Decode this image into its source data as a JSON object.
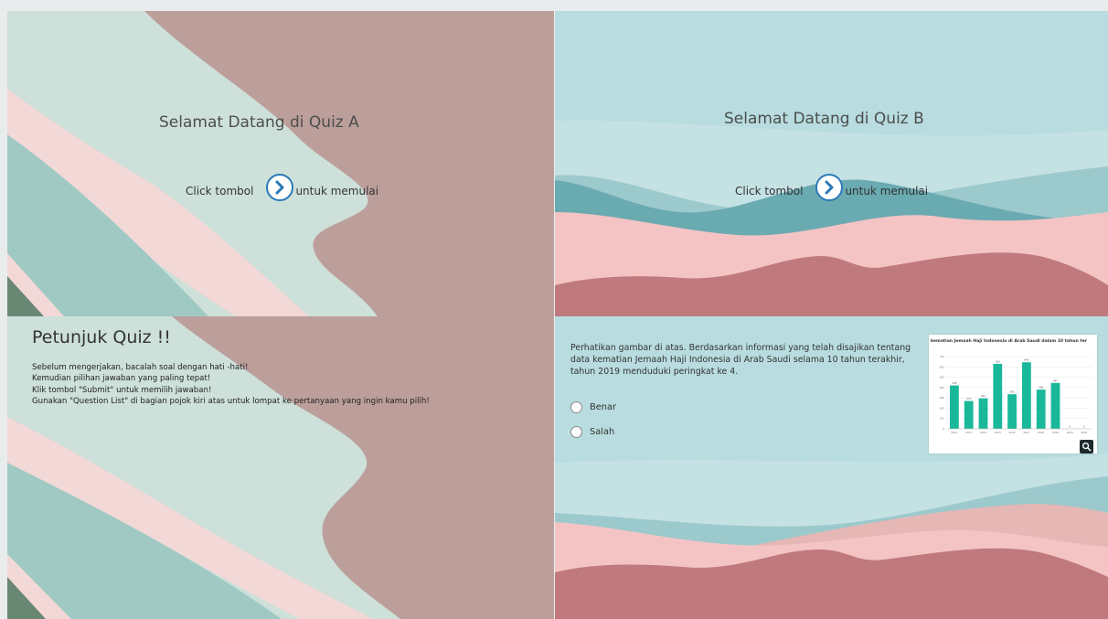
{
  "slide_a": {
    "title": "Selamat Datang di Quiz  A",
    "start_prefix": "Click tombol",
    "start_suffix": "untuk memulai"
  },
  "slide_b": {
    "title": "Selamat Datang di Quiz  B",
    "start_prefix": "Click tombol",
    "start_suffix": "untuk memulai"
  },
  "instructions": {
    "title": "Petunjuk Quiz !!",
    "lines": [
      "Sebelum mengerjakan, bacalah soal dengan hati -hati!",
      "Kemudian pilihan jawaban yang paling tepat!",
      "Klik tombol \"Submit\" untuk memilih jawaban!",
      "Gunakan \"Question List\" di bagian pojok kiri atas untuk lompat ke pertanyaan yang ingin kamu pilih!"
    ]
  },
  "question": {
    "text": "Perhatikan gambar di atas. Berdasarkan informasi yang telah disajikan tentang data kematian Jemaah Haji Indonesia di Arab Saudi selama 10 tahun terakhir, tahun 2019 menduduki peringkat ke 4.",
    "options": [
      "Benar",
      "Salah"
    ]
  },
  "chart_data": {
    "type": "bar",
    "title": "kematian Jemaah Haji Indonesia di Arab Saudi dalam 10 tahun ter",
    "categories": [
      "2012",
      "2013",
      "2014",
      "2015",
      "2016",
      "2017",
      "2018",
      "2019",
      "2020",
      "2021"
    ],
    "values": [
      420,
      270,
      295,
      630,
      335,
      645,
      380,
      445,
      0,
      0
    ],
    "ylim": [
      0,
      700
    ],
    "yticks": [
      "0",
      "100",
      "200",
      "300",
      "400",
      "500",
      "600",
      "700"
    ],
    "data_labels": [
      "428",
      "273",
      "301",
      "636",
      "342",
      "645",
      "385",
      "447",
      "0",
      "0"
    ],
    "bar_color": "#1ab89a"
  },
  "colors": {
    "mint": "#cde0d9",
    "teal": "#a0c9c4",
    "mauve": "#bc9f9b",
    "pink": "#f2d8d6",
    "dark_green": "#6a8774",
    "sky": "#b8dcdf",
    "river": "#6aaab1",
    "rose": "#f4c4c4",
    "deep_rose": "#c07a7d",
    "accent_blue": "#2a7ab8"
  },
  "icons": {
    "start": "chevron-right-circle-icon",
    "zoom": "magnifier-icon"
  }
}
